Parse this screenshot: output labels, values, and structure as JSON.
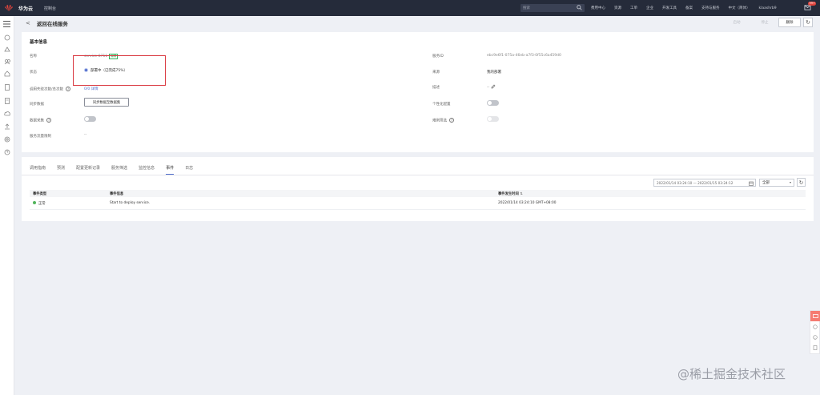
{
  "topbar": {
    "brand": "华为云",
    "console": "控制台",
    "search_placeholder": "搜索",
    "nav": [
      "费用中心",
      "资源",
      "工单",
      "企业",
      "开发工具",
      "备案",
      "支持与服务",
      "中文（简体）",
      "klaashrb9"
    ],
    "notification_count": "99+"
  },
  "header": {
    "back_label": "<",
    "title": "返回在线服务",
    "buttons": {
      "start": "启动",
      "stop": "停止",
      "delete": "删除"
    }
  },
  "basic_info": {
    "title": "基本信息",
    "labels": {
      "name": "名称",
      "status": "状态",
      "calls": "调用失败次数/总次数",
      "sync_data": "同步数据",
      "data_collect": "数据采集",
      "hard_example": "服务流量限制",
      "service_id": "服务ID",
      "source": "来源",
      "description": "描述",
      "personal_node": "个性化配置",
      "hard_sample_filter": "难例筛选"
    },
    "values": {
      "name": "service-8711",
      "name_tag": "编辑",
      "status": "部署中（已完成75%）",
      "calls": "0/0 详情",
      "sync_button": "同步数据至数据集",
      "hard_example": "--",
      "service_id": "ebc9e6f1-075a-46eb-a7f3-0f55c6a459d0",
      "source": "我的部署",
      "description": "--"
    }
  },
  "tabs": [
    "调用指南",
    "预测",
    "配置更新记录",
    "服务筛选",
    "监控信息",
    "事件",
    "日志"
  ],
  "active_tab": "事件",
  "events": {
    "date_range": "2022/01/14 03:24:10 — 2022/01/15 03:24:12",
    "filter": "全部",
    "columns": [
      "事件类型",
      "事件信息",
      "事件发生时间"
    ],
    "rows": [
      {
        "type": "正常",
        "info": "Start to deploy service.",
        "time": "2022/01/14 03:24:10 GMT+08:00"
      }
    ]
  },
  "watermark": "@稀土掘金技术社区",
  "colors": {
    "topbar": "#252b3a",
    "accent": "#526ecc",
    "highlight": "#d9363e",
    "ok": "#50b45a"
  }
}
